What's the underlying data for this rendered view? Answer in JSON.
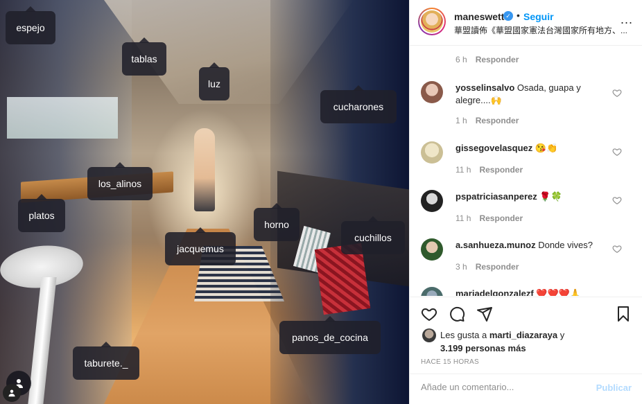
{
  "post": {
    "tags": [
      {
        "label": "espejo"
      },
      {
        "label": "tablas"
      },
      {
        "label": "luz"
      },
      {
        "label": "cucharones"
      },
      {
        "label": "los_alinos"
      },
      {
        "label": "platos"
      },
      {
        "label": "horno"
      },
      {
        "label": "cuchillos"
      },
      {
        "label": "jacquemus"
      },
      {
        "label": "panos_de_cocina"
      },
      {
        "label": "taburete._"
      }
    ]
  },
  "header": {
    "username": "maneswett",
    "verified_icon": "verified-badge-icon",
    "separator": "•",
    "follow_label": "Seguir",
    "subtitle": "華盟讀佈《華盟國家憲法台灣國家所有地方、...",
    "more_icon": "more-options-icon",
    "more_label": "..."
  },
  "comments": {
    "top_meta": {
      "time": "6 h",
      "reply": "Responder"
    },
    "items": [
      {
        "user": "yosselinsalvo",
        "text": "Osada, guapa y alegre....🙌",
        "time": "1 h",
        "reply": "Responder",
        "avatar_color": "#b98a7a"
      },
      {
        "user": "gissegovelasquez",
        "text": "😘👏",
        "time": "11 h",
        "reply": "Responder",
        "avatar_color": "#d8d0a8"
      },
      {
        "user": "pspatriciasanperez",
        "text": "🌹🍀",
        "time": "11 h",
        "reply": "Responder",
        "avatar_color": "#3a3a3a"
      },
      {
        "user": "a.sanhueza.munoz",
        "text": "Donde vives?",
        "time": "3 h",
        "reply": "Responder",
        "avatar_color": "#3f6b3a"
      },
      {
        "user": "mariadelgonzalezf",
        "text": "❤️❤️❤️🙏",
        "time": "",
        "reply": "",
        "avatar_color": "#4a6b6a"
      }
    ]
  },
  "actions": {
    "like_icon": "heart-icon",
    "comment_icon": "comment-icon",
    "share_icon": "share-icon",
    "save_icon": "bookmark-icon"
  },
  "likes": {
    "prefix": "Les gusta a ",
    "user": "marti_diazaraya",
    "middle": " y",
    "count": "3.199 personas más"
  },
  "timestamp": "HACE 15 HORAS",
  "add_comment": {
    "placeholder": "Añade un comentario...",
    "post_label": "Publicar"
  },
  "colors": {
    "accent": "#0095f6",
    "post_disabled": "#b3dbff",
    "text": "#262626",
    "muted": "#8e8e8e"
  }
}
